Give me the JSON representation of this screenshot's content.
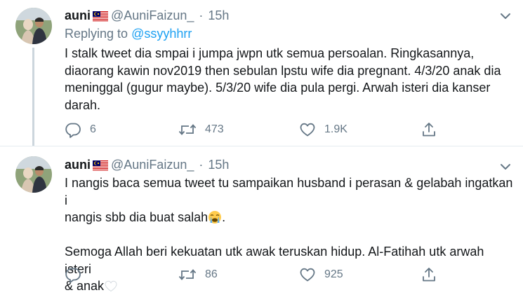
{
  "tweets": [
    {
      "author": {
        "name": "auni",
        "handle": "@AuniFaizun_",
        "flag": "malaysia-flag"
      },
      "time": "15h",
      "dot": "·",
      "replying_to_label": "Replying to",
      "replying_to_handle": "@ssyyhhrr",
      "text": "I stalk tweet dia smpai i jumpa jwpn utk semua persoalan. Ringkasannya,\ndiaorang kawin nov2019 then sebulan lpstu wife dia pregnant. 4/3/20 anak dia\nmeninggal (gugur maybe). 5/3/20 wife dia pula pergi. Arwah isteri dia kanser\ndarah.",
      "replies": "6",
      "retweets": "473",
      "likes": "1.9K"
    },
    {
      "author": {
        "name": "auni",
        "handle": "@AuniFaizun_",
        "flag": "malaysia-flag"
      },
      "time": "15h",
      "dot": "·",
      "text_line1": "I nangis baca semua tweet tu sampaikan husband i perasan & gelabah ingatkan i",
      "text_line2a": "nangis sbb dia buat salah",
      "text_line2b": ".",
      "text_line3": "Semoga Allah beri kekuatan utk awak teruskan hidup. Al-Fatihah utk arwah isteri",
      "text_line4": "& anak",
      "emoji1": "loudly-crying-face",
      "emoji2": "white-heart",
      "replies": "",
      "retweets": "86",
      "likes": "925"
    }
  ],
  "colors": {
    "text": "#14171a",
    "muted": "#657786",
    "link": "#1da1f2",
    "divider": "#e6ecf0"
  },
  "icons": [
    "caret-down-icon",
    "reply-icon",
    "retweet-icon",
    "like-icon",
    "share-icon"
  ]
}
